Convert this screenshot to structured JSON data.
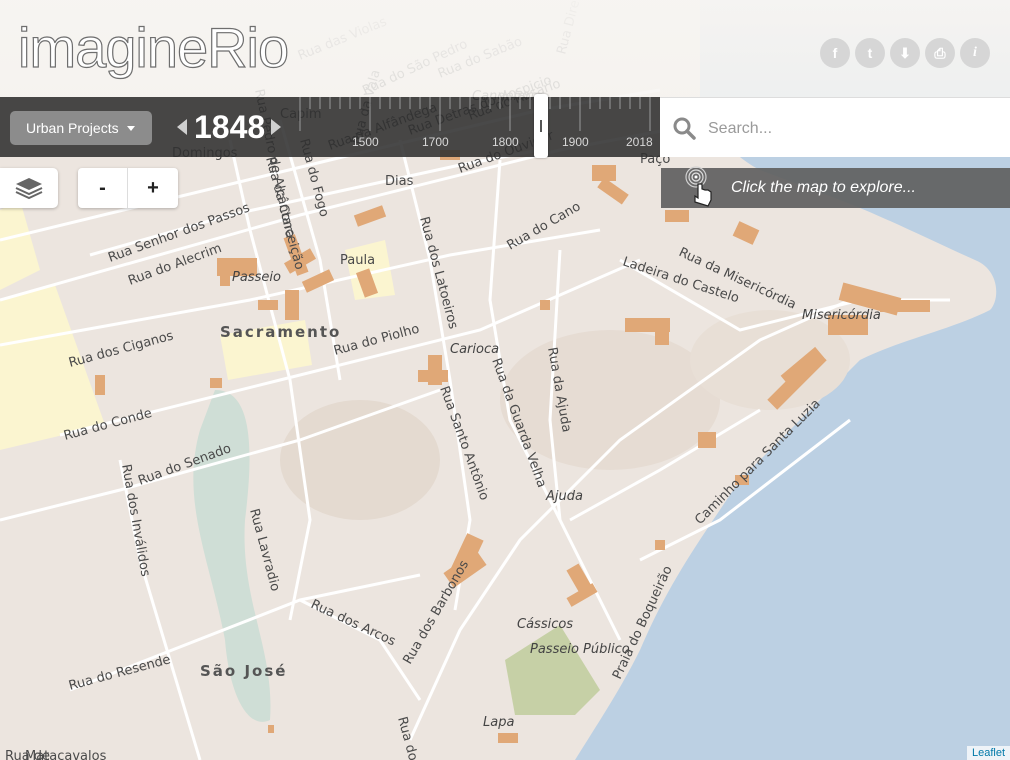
{
  "app": {
    "title": "imagineRio"
  },
  "social": [
    {
      "name": "facebook",
      "glyph": "f"
    },
    {
      "name": "twitter",
      "glyph": "t"
    },
    {
      "name": "download",
      "glyph": "⬇"
    },
    {
      "name": "print",
      "glyph": "⎙"
    },
    {
      "name": "info",
      "glyph": "i"
    }
  ],
  "timeline": {
    "layer_dropdown_label": "Urban Projects",
    "year": "1848",
    "ticks": [
      "1500",
      "1700",
      "1800",
      "1900",
      "2018"
    ]
  },
  "search": {
    "placeholder": "Search..."
  },
  "probe": {
    "text": "Click the map to explore..."
  },
  "zoom": {
    "out_label": "-",
    "in_label": "+"
  },
  "attribution": "Leaflet",
  "colors": {
    "water": "#bcd0e3",
    "land": "#ece5df",
    "buildings": "#e0a877",
    "parks": "#fbf5d0",
    "green": "#c6d0a6"
  },
  "map_labels": {
    "streets": [
      "Rua das Violas",
      "Rua do São Pedro",
      "Rua do Sabão",
      "Rua Direita",
      "Rua da Alfândega",
      "Rua Detras do Hospicio",
      "Rua do Rosário",
      "Capim",
      "Domingos",
      "Rua Pedro de Alcântara",
      "Rua da Conceição",
      "Rua do Fogo",
      "Rua da Vala",
      "Dias",
      "Rua do Ouvidor",
      "Paço",
      "Rua Senhor dos Passos",
      "Rua do Alecrim",
      "Paula",
      "Rua dos Latoeiros",
      "Rua do Cano",
      "Rua da Misericórdia",
      "Ladeira do Castelo",
      "Rua do Piolho",
      "Rua dos Ciganos",
      "Rua do Conde",
      "Rua da Guarda Velha",
      "Rua da Ajuda",
      "Rua Santo Antônio",
      "Rua do Senado",
      "Rua dos Inválidos",
      "Rua Lavradio",
      "Rua dos Arcos",
      "Rua dos Barbonos",
      "Rua do Resende",
      "Caminho para Santa Luzia",
      "Praia do Boqueirão",
      "Rua de",
      "Matacavalos",
      "Rua do"
    ],
    "places": [
      "Candelaria",
      "Passeio",
      "Carioca",
      "Misericórdia",
      "Ajuda",
      "Cássicos",
      "Passeio Público",
      "Lapa"
    ],
    "districts": [
      "Sacramento",
      "São José"
    ]
  }
}
